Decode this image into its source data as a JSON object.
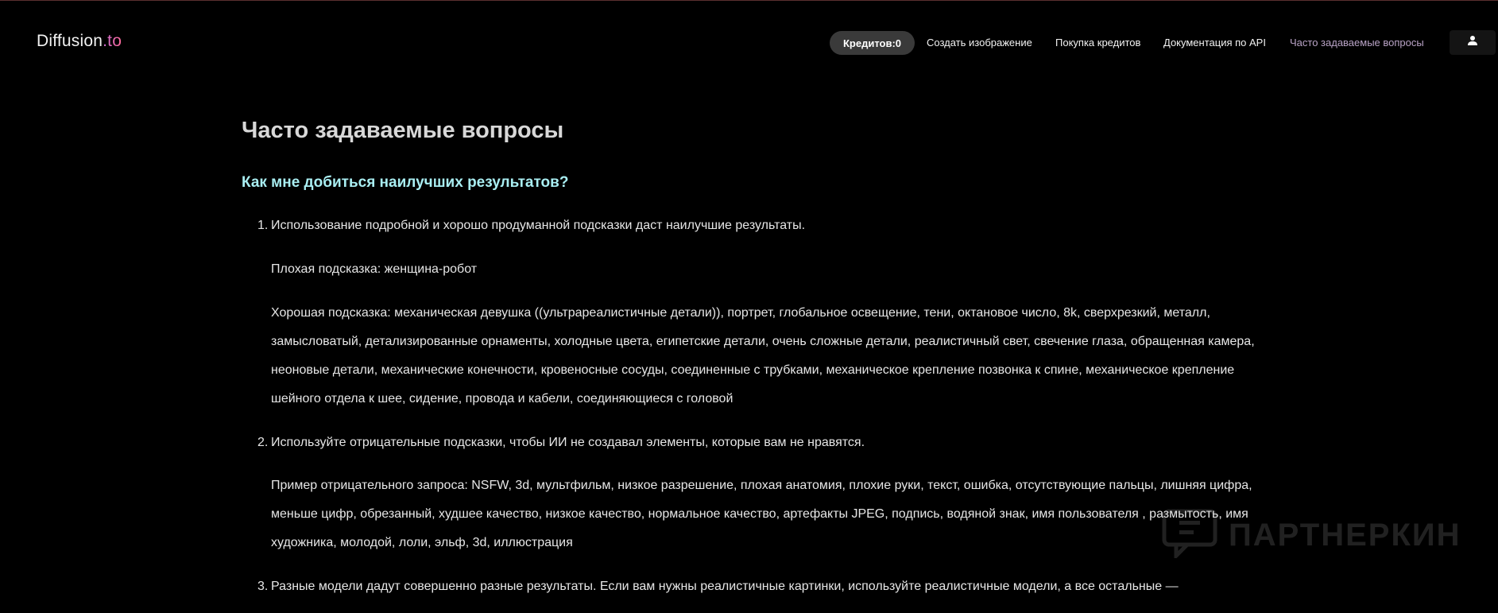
{
  "header": {
    "logo_prefix": "Diffusion",
    "logo_suffix": ".to",
    "credits": "Кредитов:0",
    "nav": {
      "create": "Создать изображение",
      "buy": "Покупка кредитов",
      "docs": "Документация по API",
      "faq": "Часто задаваемые вопросы"
    },
    "user_icon": "user-icon"
  },
  "page": {
    "title": "Часто задаваемые вопросы",
    "section_title": "Как мне добиться наилучших результатов?",
    "items": [
      {
        "number": "1.",
        "text": "Использование подробной и хорошо продуманной подсказки даст наилучшие результаты.",
        "bad_prompt": "Плохая подсказка: женщина-робот",
        "good_prompt_lines": [
          "Хорошая подсказка: механическая девушка ((ультрареалистичные детали)), портрет, глобальное освещение, тени, октановое число, 8k, сверхрезкий, металл,",
          "замысловатый, детализированные орнаменты, холодные цвета, египетские детали, очень сложные детали, реалистичный свет, свечение глаза, обращенная камера,",
          "неоновые детали, механические конечности, кровеносные сосуды, соединенные с трубками, механическое крепление позвонка к спине, механическое крепление",
          "шейного отдела к шее, сидение, провода и кабели, соединяющиеся с головой"
        ]
      },
      {
        "number": "2.",
        "text": "Используйте отрицательные подсказки, чтобы ИИ не создавал элементы, которые вам не нравятся.",
        "example_lines": [
          "Пример отрицательного запроса: NSFW, 3d, мультфильм, низкое разрешение, плохая анатомия, плохие руки, текст, ошибка, отсутствующие пальцы, лишняя цифра,",
          "меньше цифр, обрезанный, худшее качество, низкое качество, нормальное качество, артефакты JPEG, подпись, водяной знак, имя пользователя , размытость, имя",
          "художника, молодой, лоли, эльф, 3d, иллюстрация"
        ]
      },
      {
        "number": "3.",
        "text": "Разные модели дадут совершенно разные результаты. Если вам нужны реалистичные картинки, используйте реалистичные модели, а все остальные —"
      }
    ]
  },
  "watermark": {
    "text": "ПАРТНЕРКИН",
    "icon": "chat-bubble-icon"
  },
  "colors": {
    "background": "#000000",
    "heading": "#d8d8d8",
    "section_heading": "#a9eef2",
    "credits_pill": "#3a3a3a",
    "faq_link": "#b9a3c6"
  }
}
